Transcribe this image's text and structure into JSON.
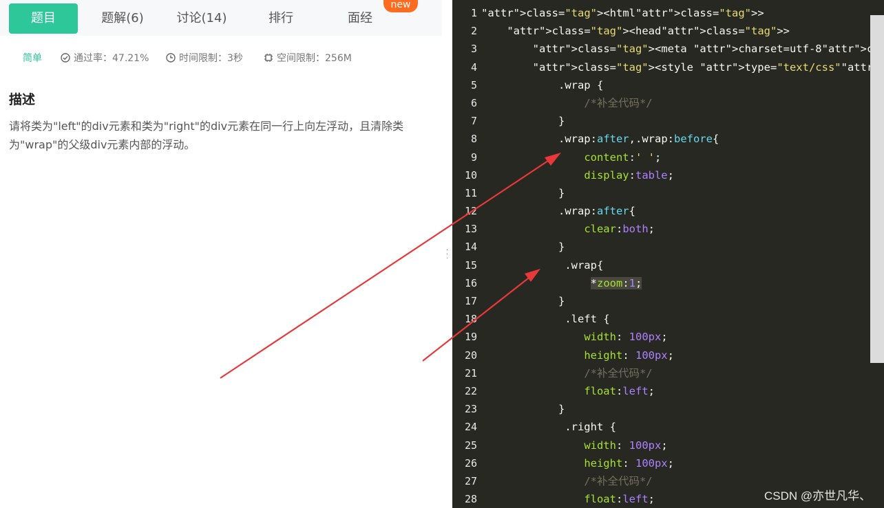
{
  "tabs": [
    {
      "label": "题目"
    },
    {
      "label": "题解(6)"
    },
    {
      "label": "讨论(14)"
    },
    {
      "label": "排行"
    },
    {
      "label": "面经"
    }
  ],
  "new_badge": "new",
  "meta": {
    "difficulty": "简单",
    "pass_rate": "通过率：47.21%",
    "time_limit": "时间限制：3秒",
    "space_limit": "空间限制：256M"
  },
  "description": {
    "heading": "描述",
    "text": "请将类为\"left\"的div元素和类为\"right\"的div元素在同一行上向左浮动，且清除类为\"wrap\"的父级div元素内部的浮动。"
  },
  "code_lines": [
    "<html>",
    "    <head>",
    "        <meta charset=utf-8>",
    "        <style type=\"text/css\">",
    "            .wrap {",
    "                /*补全代码*/",
    "            }",
    "            .wrap:after,.wrap:before{",
    "                content:' ';",
    "                display:table;",
    "            }",
    "            .wrap:after{",
    "                clear:both;",
    "            }",
    "             .wrap{",
    "                 *zoom:1;",
    "            }",
    "             .left {",
    "                width: 100px;",
    "                height: 100px;",
    "                /*补全代码*/",
    "                float:left;",
    "            }",
    "             .right {",
    "                width: 100px;",
    "                height: 100px;",
    "                /*补全代码*/",
    "                float:left;"
  ],
  "watermark": "CSDN @亦世凡华、",
  "colors": {
    "accent": "#2ec799",
    "badge": "#ff6b1f",
    "editor_bg": "#272822",
    "arrow": "#e8383a"
  }
}
